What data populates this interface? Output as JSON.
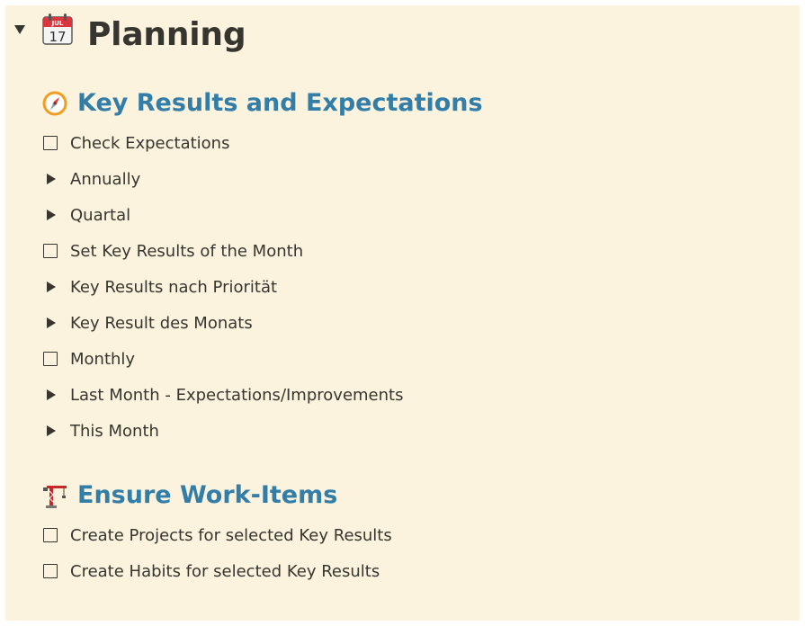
{
  "page": {
    "title": "Planning",
    "icon": "calendar-icon",
    "calendar_month": "JUL",
    "calendar_day": "17"
  },
  "sections": [
    {
      "title": "Key Results and Expectations",
      "icon": "compass-icon",
      "items": [
        {
          "type": "todo",
          "label": "Check Expectations",
          "checked": false
        },
        {
          "type": "toggle",
          "label": "Annually"
        },
        {
          "type": "toggle",
          "label": "Quartal"
        },
        {
          "type": "todo",
          "label": "Set Key Results of the Month",
          "checked": false
        },
        {
          "type": "toggle",
          "label": "Key Results nach Priorität"
        },
        {
          "type": "toggle",
          "label": "Key Result des Monats"
        },
        {
          "type": "todo",
          "label": "Monthly",
          "checked": false
        },
        {
          "type": "toggle",
          "label": "Last Month - Expectations/Improvements"
        },
        {
          "type": "toggle",
          "label": "This Month"
        }
      ]
    },
    {
      "title": "Ensure Work-Items",
      "icon": "crane-icon",
      "items": [
        {
          "type": "todo",
          "label": "Create Projects for selected Key Results",
          "checked": false
        },
        {
          "type": "todo",
          "label": "Create Habits for selected Key Results",
          "checked": false
        }
      ]
    }
  ],
  "colors": {
    "background": "#fbf3dd",
    "heading": "#337ea9",
    "text": "#37352f"
  }
}
